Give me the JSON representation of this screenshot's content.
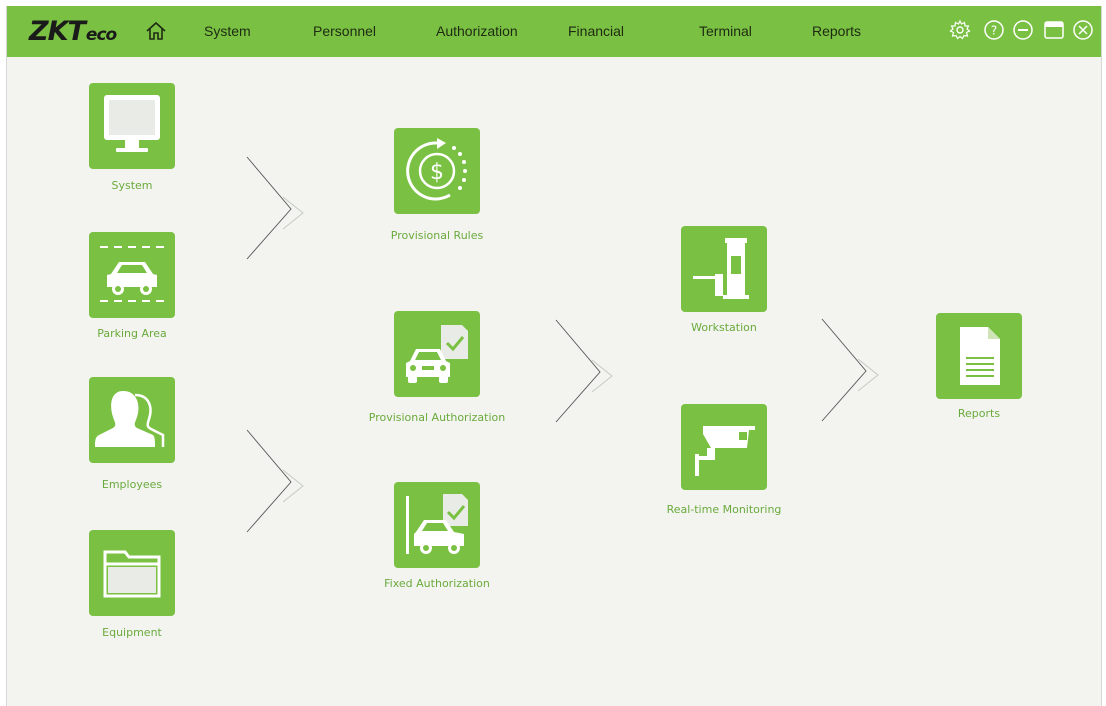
{
  "header": {
    "logo_main": "ZKT",
    "logo_sub": "eco",
    "home_icon": "home-icon",
    "menu": [
      {
        "label": "System"
      },
      {
        "label": "Personnel"
      },
      {
        "label": "Authorization"
      },
      {
        "label": "Financial"
      },
      {
        "label": "Terminal"
      },
      {
        "label": "Reports"
      }
    ],
    "window_controls": [
      "gear-icon",
      "help-icon",
      "minimize-icon",
      "maximize-icon",
      "close-icon"
    ]
  },
  "flow": {
    "setup": [
      {
        "label": "System",
        "icon": "monitor-icon"
      },
      {
        "label": "Parking Area",
        "icon": "parking-car-icon"
      },
      {
        "label": "Employees",
        "icon": "people-icon"
      },
      {
        "label": "Equipment",
        "icon": "folder-icon"
      }
    ],
    "authorization": [
      {
        "label": "Provisional Rules",
        "icon": "dollar-cycle-icon"
      },
      {
        "label": "Provisional Authorization",
        "icon": "car-approved-icon"
      },
      {
        "label": "Fixed Authorization",
        "icon": "car-gate-approved-icon"
      }
    ],
    "operation": [
      {
        "label": "Workstation",
        "icon": "barrier-gate-icon"
      },
      {
        "label": "Real-time Monitoring",
        "icon": "cctv-camera-icon"
      }
    ],
    "output": [
      {
        "label": "Reports",
        "icon": "document-icon"
      }
    ]
  },
  "colors": {
    "brand_green": "#7ac143",
    "label_green": "#6aaa3c",
    "background": "#f3f4f0"
  }
}
